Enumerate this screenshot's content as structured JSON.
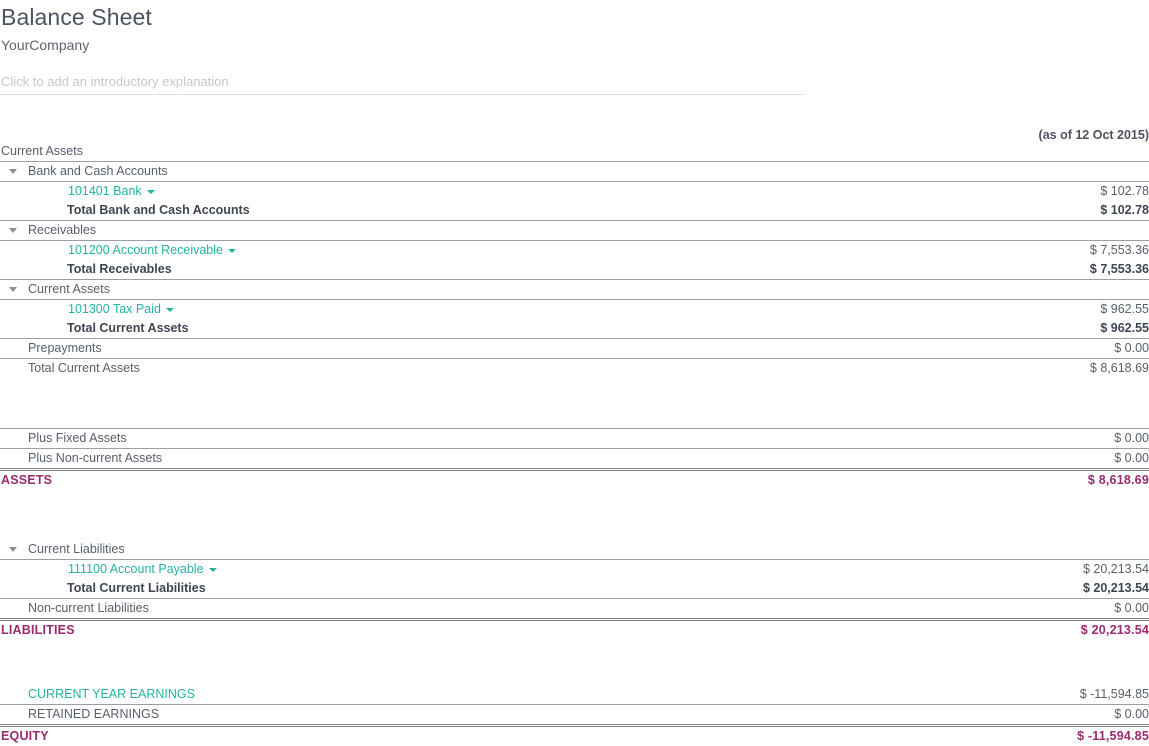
{
  "header": {
    "title": "Balance Sheet",
    "company": "YourCompany",
    "intro_placeholder": "Click to add an introductory explanation",
    "as_of": "(as of 12 Oct 2015)"
  },
  "colors": {
    "accent_link": "#22b3a3",
    "total_purple": "#9c2a6e",
    "text": "#58606c"
  },
  "rows": {
    "current_assets_header": "Current Assets",
    "bank_and_cash_group": "Bank and Cash Accounts",
    "bank_account": "101401 Bank",
    "bank_amount": "$ 102.78",
    "total_bank_label": "Total Bank and Cash Accounts",
    "total_bank_amount": "$ 102.78",
    "receivables_group": "Receivables",
    "receivable_account": "101200 Account Receivable",
    "receivable_amount": "$ 7,553.36",
    "total_receivables_label": "Total Receivables",
    "total_receivables_amount": "$ 7,553.36",
    "current_assets_group": "Current Assets",
    "tax_paid_account": "101300 Tax Paid",
    "tax_paid_amount": "$ 962.55",
    "total_current_assets_label": "Total Current Assets",
    "total_current_assets_amount": "$ 962.55",
    "prepayments_label": "Prepayments",
    "prepayments_amount": "$ 0.00",
    "grand_total_current_assets_label": "Total Current Assets",
    "grand_total_current_assets_amount": "$ 8,618.69",
    "plus_fixed_assets_label": "Plus Fixed Assets",
    "plus_fixed_assets_amount": "$ 0.00",
    "plus_noncurrent_assets_label": "Plus Non-current Assets",
    "plus_noncurrent_assets_amount": "$ 0.00",
    "assets_label": "ASSETS",
    "assets_amount": "$ 8,618.69",
    "current_liabilities_group": "Current Liabilities",
    "payable_account": "111100 Account Payable",
    "payable_amount": "$ 20,213.54",
    "total_current_liabilities_label": "Total Current Liabilities",
    "total_current_liabilities_amount": "$ 20,213.54",
    "noncurrent_liabilities_label": "Non-current Liabilities",
    "noncurrent_liabilities_amount": "$ 0.00",
    "liabilities_label": "LIABILITIES",
    "liabilities_amount": "$ 20,213.54",
    "current_year_earnings_label": "CURRENT YEAR EARNINGS",
    "current_year_earnings_amount": "$ -11,594.85",
    "retained_earnings_label": "RETAINED EARNINGS",
    "retained_earnings_amount": "$ 0.00",
    "equity_label": "EQUITY",
    "equity_amount": "$ -11,594.85"
  }
}
